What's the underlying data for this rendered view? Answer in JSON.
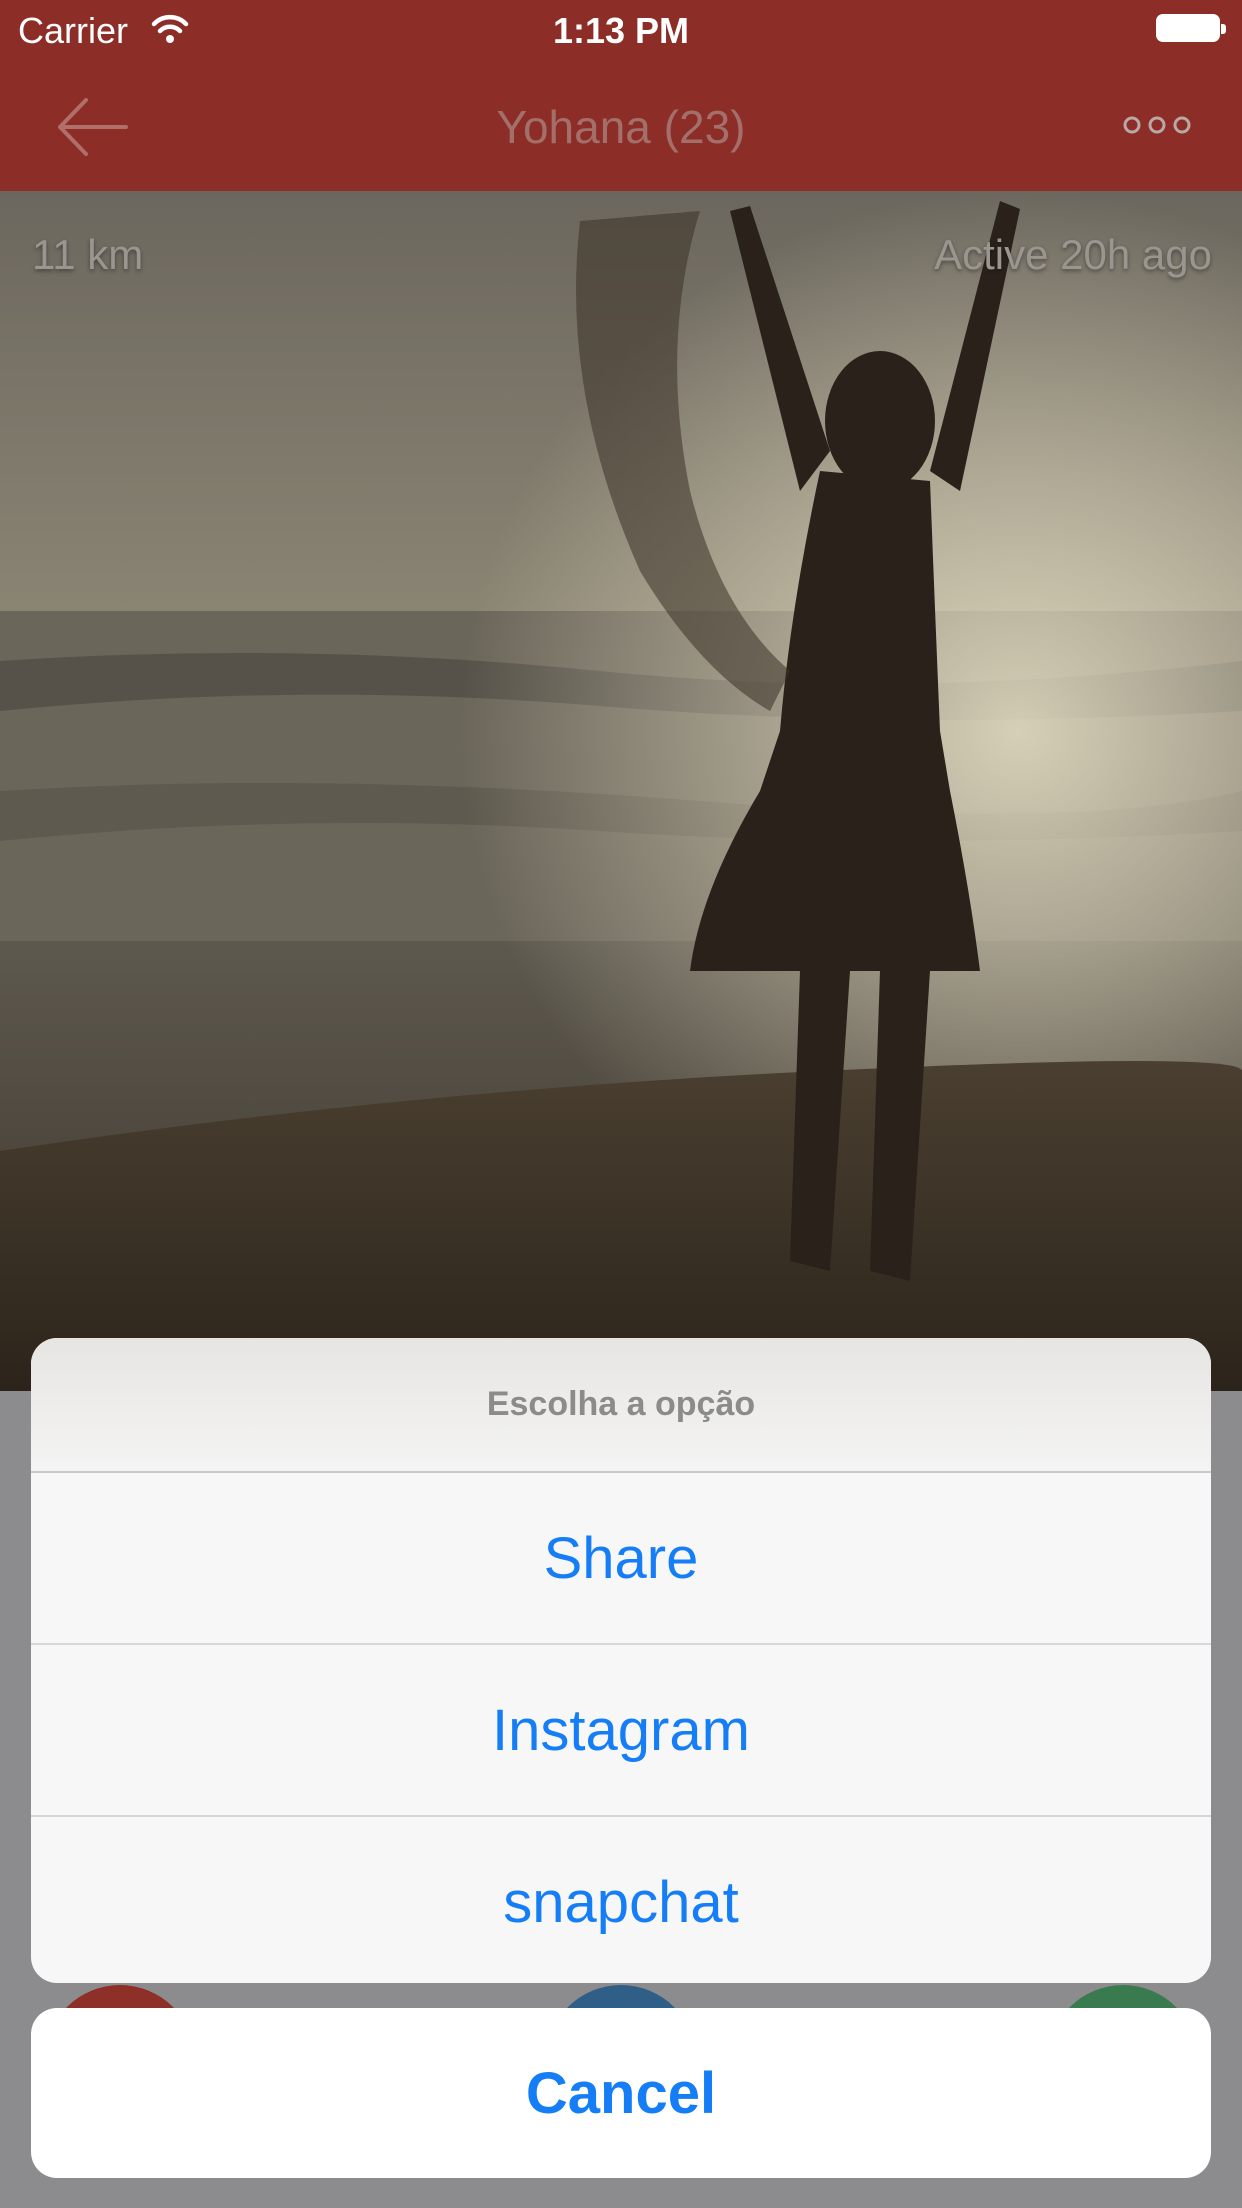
{
  "status_bar": {
    "carrier": "Carrier",
    "time": "1:13 PM",
    "wifi_icon": "wifi-icon",
    "battery_icon": "battery-icon"
  },
  "navbar": {
    "title": "Yohana (23)",
    "back_icon": "arrow-left-icon",
    "more_icon": "more-dots-icon",
    "background_color": "#8c2e27"
  },
  "profile": {
    "distance": "11 km",
    "active_status": "Active 20h ago",
    "photo_description_icon": "profile-photo"
  },
  "action_sheet": {
    "title": "Escolha a opção",
    "options": [
      "Share",
      "Instagram",
      "snapchat"
    ],
    "cancel_label": "Cancel",
    "accent_color": "#157ef6"
  }
}
